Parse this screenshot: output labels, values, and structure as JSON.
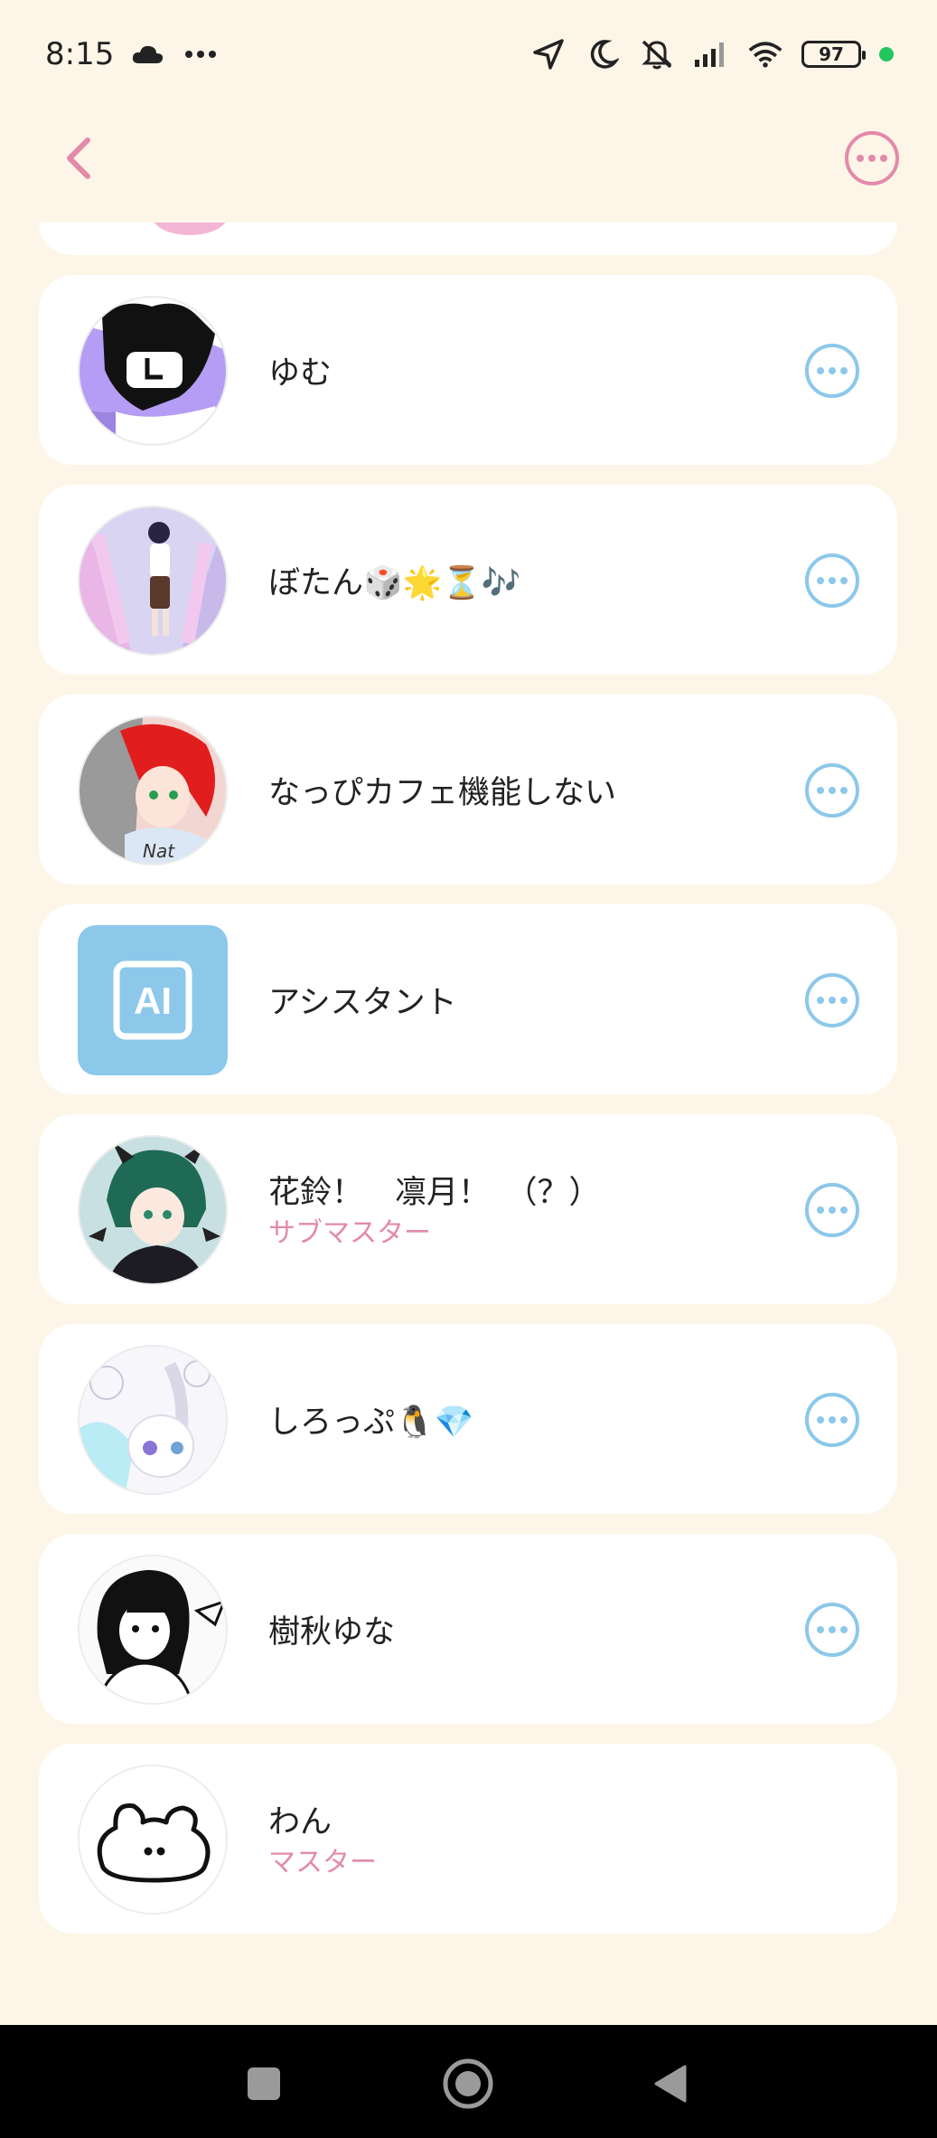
{
  "status_bar": {
    "time": "8:15",
    "icons_left": [
      "cloud-icon",
      "more-dots-icon"
    ],
    "icons_right": [
      "location-arrow-icon",
      "moon-icon",
      "vibrate-off-icon",
      "signal-icon",
      "wifi-icon"
    ],
    "battery": "97"
  },
  "header": {
    "back_icon": "chevron-left-icon",
    "more_icon": "more-circle-icon"
  },
  "members": [
    {
      "name": "ゆむ",
      "role": "",
      "avatar": "purple-character",
      "has_more": true
    },
    {
      "name": "ぼたん🎲🌟⏳🎶",
      "role": "",
      "avatar": "anime-girl-pink",
      "has_more": true
    },
    {
      "name": "なっぴカフェ機能しない",
      "role": "",
      "avatar": "red-hair-girl",
      "has_more": true
    },
    {
      "name": "アシスタント",
      "role": "",
      "avatar": "ai-badge",
      "avatar_text": "AI",
      "has_more": true
    },
    {
      "name": "花鈴！　凛月！　（？）",
      "role": "サブマスター",
      "avatar": "green-hair-demon",
      "has_more": true
    },
    {
      "name": "しろっぷ🐧💎",
      "role": "",
      "avatar": "pastel-bunny",
      "has_more": true
    },
    {
      "name": "樹秋ゆな",
      "role": "",
      "avatar": "manga-girl",
      "has_more": true
    },
    {
      "name": "わん",
      "role": "マスター",
      "avatar": "white-blob",
      "has_more": false
    }
  ],
  "colors": {
    "background": "#fdf6e8",
    "accent_pink": "#e38aa9",
    "accent_blue": "#8cc8ea"
  }
}
